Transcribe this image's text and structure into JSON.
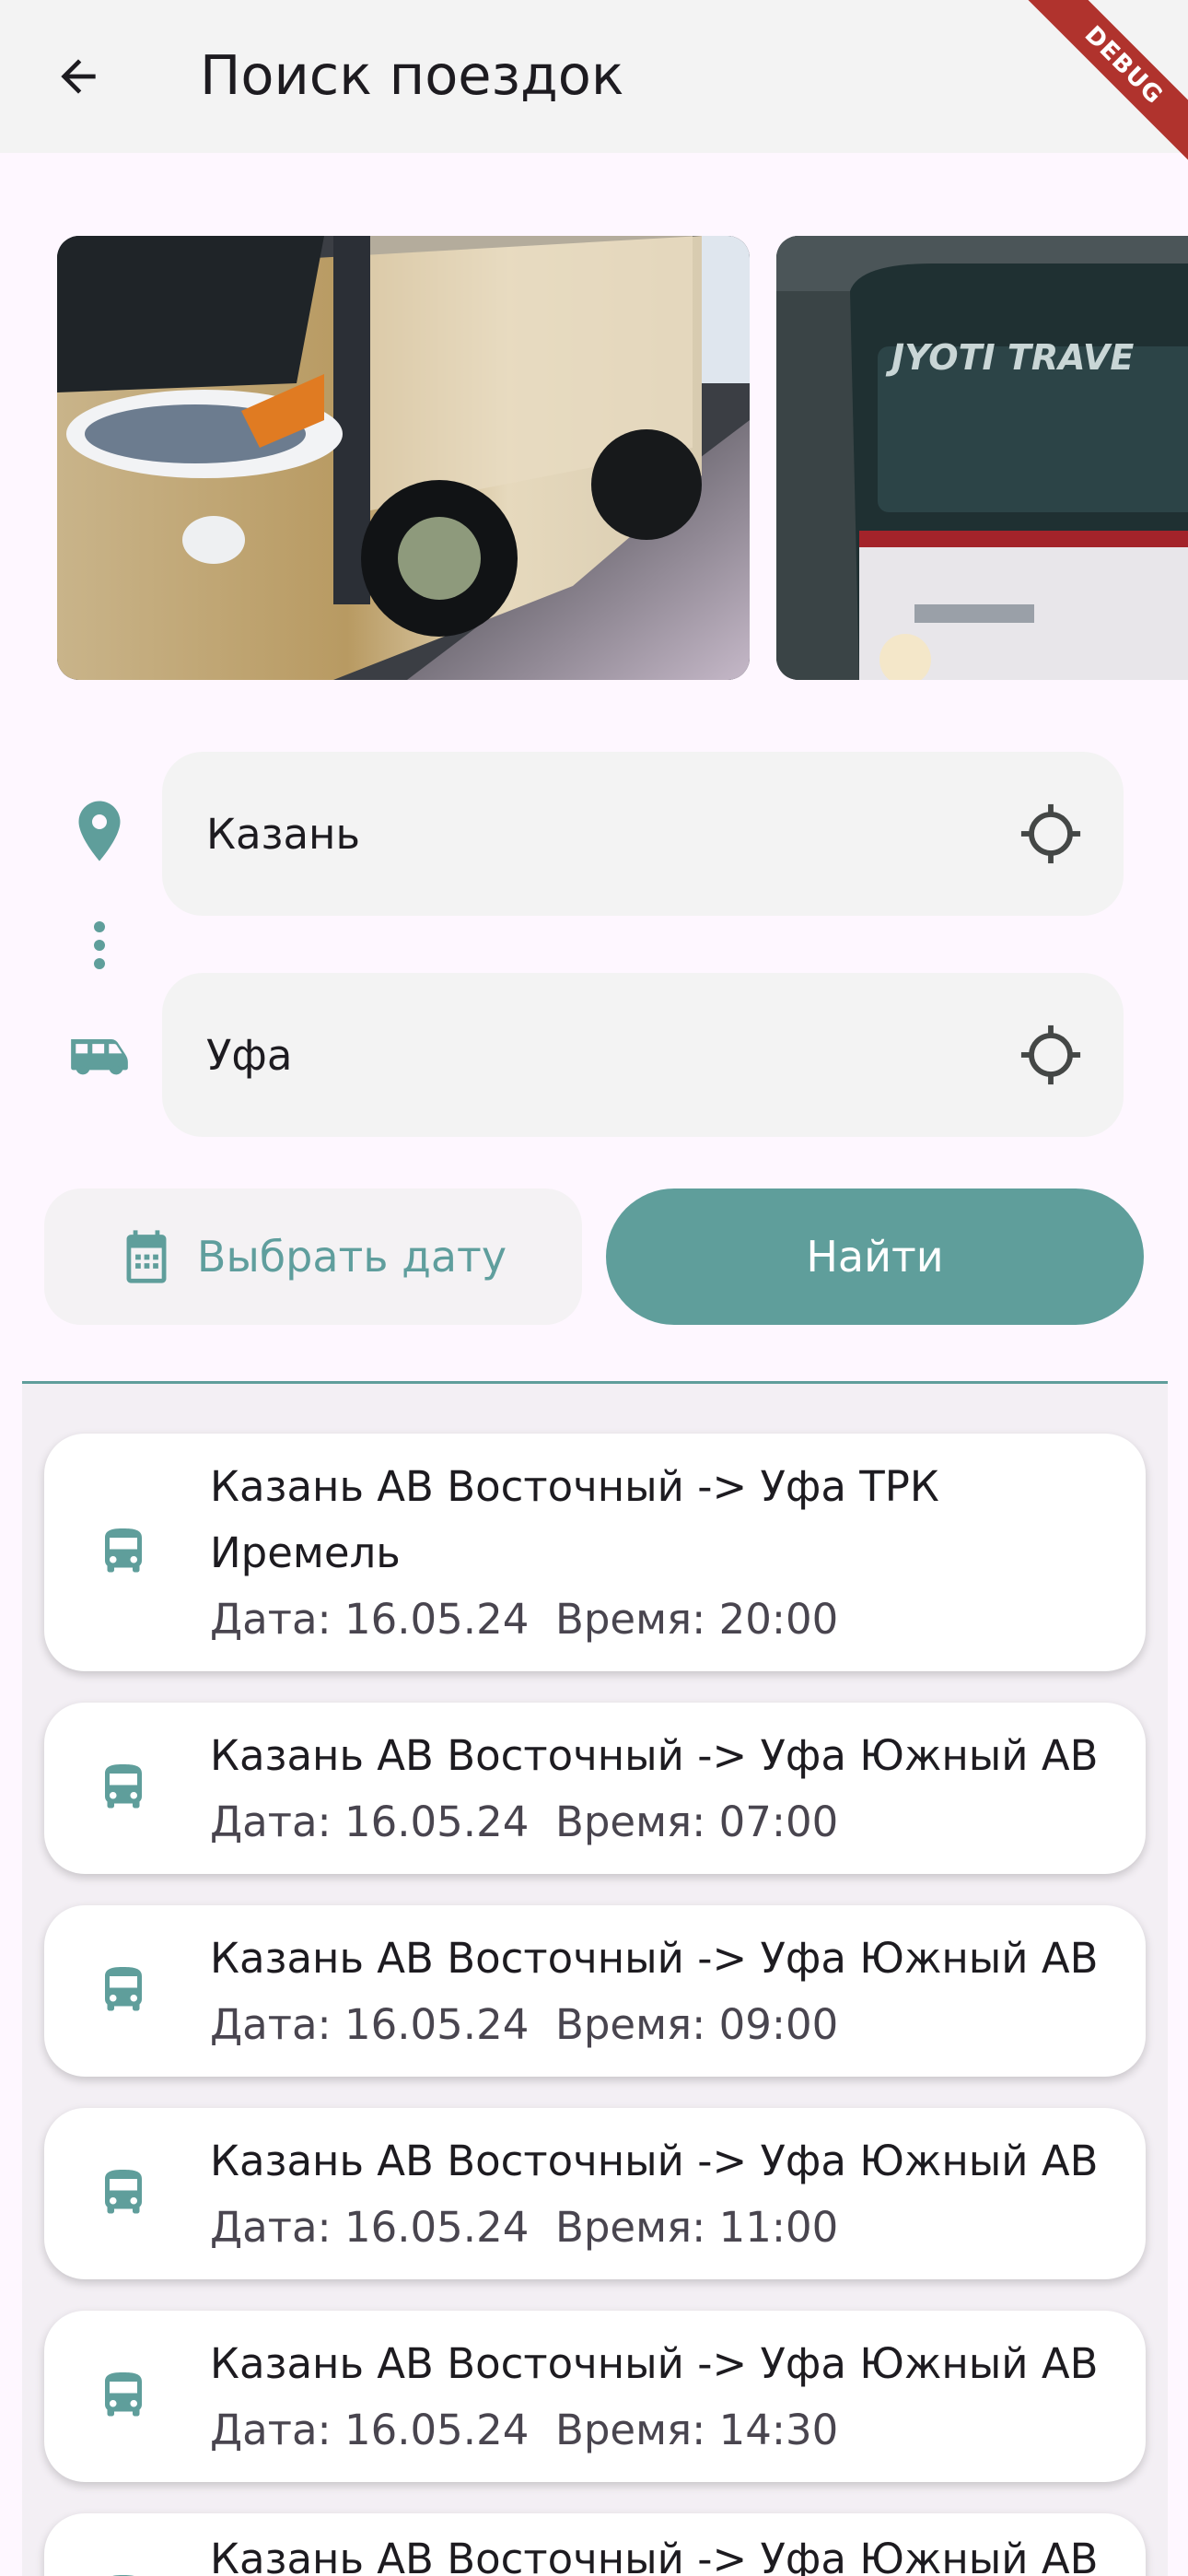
{
  "appbar": {
    "title": "Поиск поездок",
    "back_icon": "arrow-back-icon",
    "debug_banner": "DEBUG"
  },
  "carousel": {
    "images": [
      {
        "name": "gold-bus-photo"
      },
      {
        "name": "jyoti-travels-bus-photo",
        "visible_text": "JYOTI TRAVE"
      }
    ]
  },
  "route": {
    "from": {
      "value": "Казань",
      "icon": "location-pin-icon",
      "action_icon": "gps-target-icon"
    },
    "to": {
      "value": "Уфа",
      "icon": "bus-side-icon",
      "action_icon": "gps-target-icon"
    },
    "connector_icon": "vertical-dots-icon"
  },
  "actions": {
    "date_label": "Выбрать дату",
    "date_icon": "calendar-icon",
    "search_label": "Найти"
  },
  "colors": {
    "accent": "#5f9e9b",
    "background": "#fef7ff",
    "surface": "#f3f3f3",
    "debug": "#b0332d"
  },
  "trips": [
    {
      "title": "Казань АВ Восточный -> Уфа ТРК Иремель",
      "meta": "Дата: 16.05.24  Время: 20:00"
    },
    {
      "title": "Казань АВ Восточный -> Уфа Южный АВ",
      "meta": "Дата: 16.05.24  Время: 07:00"
    },
    {
      "title": "Казань АВ Восточный -> Уфа Южный АВ",
      "meta": "Дата: 16.05.24  Время: 09:00"
    },
    {
      "title": "Казань АВ Восточный -> Уфа Южный АВ",
      "meta": "Дата: 16.05.24  Время: 11:00"
    },
    {
      "title": "Казань АВ Восточный -> Уфа Южный АВ",
      "meta": "Дата: 16.05.24  Время: 14:30"
    },
    {
      "title": "Казань АВ Восточный -> Уфа Южный АВ",
      "meta": ""
    }
  ]
}
